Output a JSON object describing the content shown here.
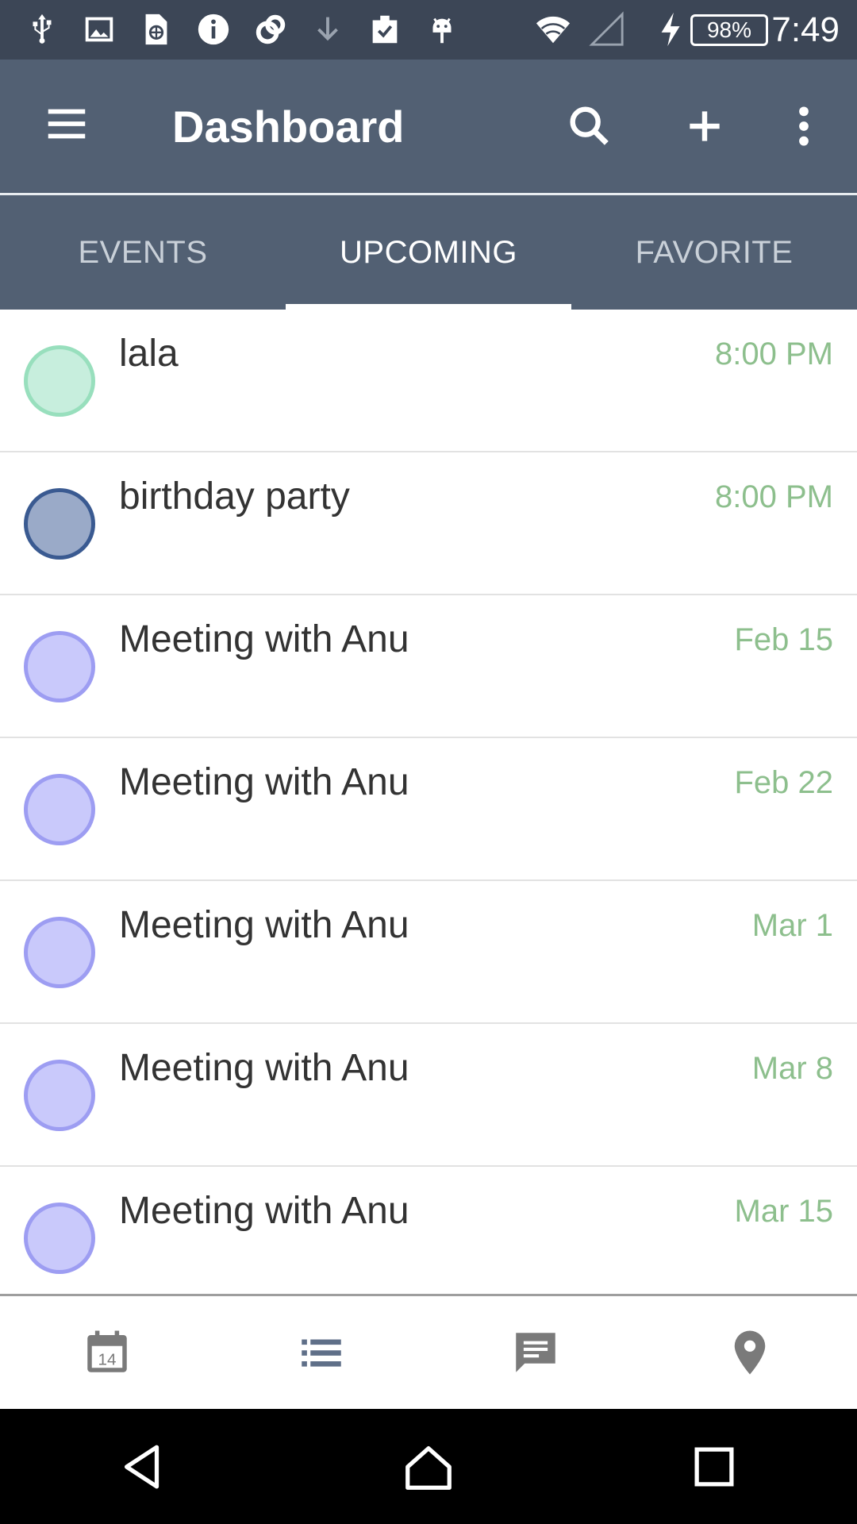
{
  "status_bar": {
    "time": "7:49",
    "battery": "98%",
    "icons": [
      "usb-icon",
      "image-icon",
      "sim-card-icon",
      "info-icon",
      "sync-icon",
      "download-icon",
      "clipboard-check-icon",
      "android-icon",
      "wifi-icon",
      "signal-icon",
      "charging-icon"
    ]
  },
  "app_bar": {
    "title": "Dashboard",
    "actions": [
      "search-icon",
      "add-icon",
      "more-vert-icon"
    ]
  },
  "tabs": [
    {
      "label": "EVENTS",
      "active": false
    },
    {
      "label": "UPCOMING",
      "active": true
    },
    {
      "label": "FAVORITE",
      "active": false
    }
  ],
  "events": [
    {
      "name": "lala",
      "when": "8:00 PM",
      "fill": "#c7eedd",
      "stroke": "#98dfbd"
    },
    {
      "name": "birthday party",
      "when": "8:00 PM",
      "fill": "#9aaac8",
      "stroke": "#3a5a91"
    },
    {
      "name": "Meeting with Anu",
      "when": "Feb 15",
      "fill": "#c9c9fb",
      "stroke": "#9d9df2"
    },
    {
      "name": "Meeting with Anu",
      "when": "Feb 22",
      "fill": "#c9c9fb",
      "stroke": "#9d9df2"
    },
    {
      "name": "Meeting with Anu",
      "when": "Mar 1",
      "fill": "#c9c9fb",
      "stroke": "#9d9df2"
    },
    {
      "name": "Meeting with Anu",
      "when": "Mar 8",
      "fill": "#c9c9fb",
      "stroke": "#9d9df2"
    },
    {
      "name": "Meeting with Anu",
      "when": "Mar 15",
      "fill": "#c9c9fb",
      "stroke": "#9d9df2"
    }
  ],
  "bottom_nav": {
    "calendar_day": "14",
    "items": [
      "calendar-icon",
      "list-icon",
      "chat-icon",
      "location-icon"
    ]
  },
  "colors": {
    "status_bar": "#3c4656",
    "app_bar": "#526073",
    "time_text": "#8dbf8d",
    "nav_icon": "#7a7a7a"
  }
}
